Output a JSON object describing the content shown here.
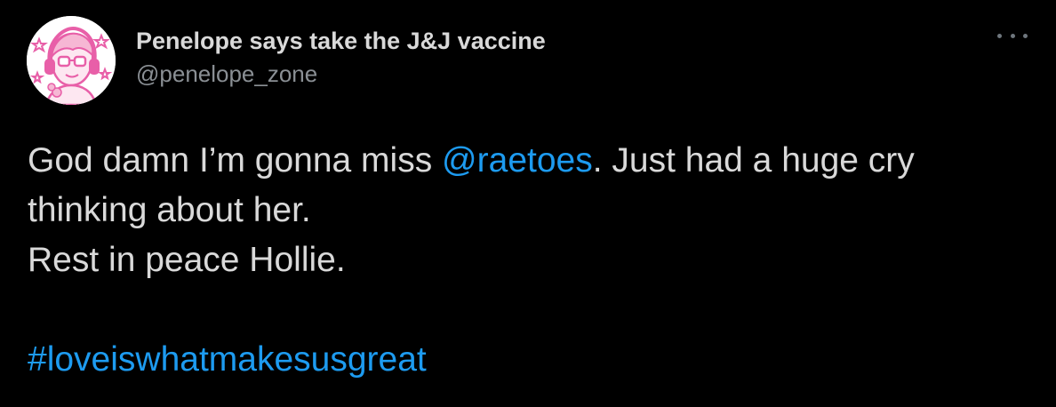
{
  "tweet": {
    "author": {
      "display_name": "Penelope says take the J&J vaccine",
      "handle": "@penelope_zone",
      "avatar_icon": "avatar-illustration-icon"
    },
    "more_icon": "more-options-icon",
    "body": {
      "line1_pre": "God damn I’m gonna miss ",
      "mention": "@raetoes",
      "line1_post": ". Just had a huge cry",
      "line2": "thinking about her.",
      "line3": "Rest in peace Hollie.",
      "hashtag": "#loveiswhatmakesusgreat"
    },
    "colors": {
      "background": "#000000",
      "text": "#d9d9d9",
      "secondary_text": "#8a8f94",
      "link": "#1d9bf0",
      "avatar_accent": "#e85fa8"
    }
  }
}
